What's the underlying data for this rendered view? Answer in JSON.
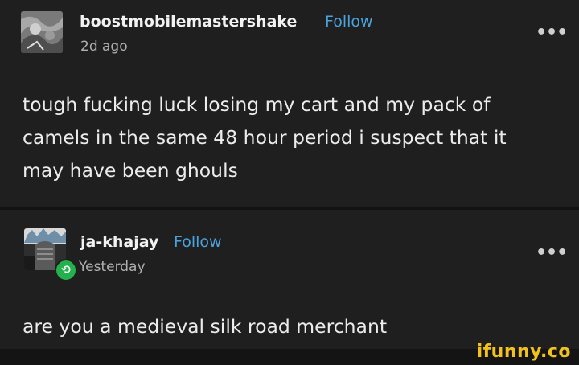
{
  "posts": [
    {
      "username": "boostmobilemastershake",
      "follow_label": "Follow",
      "timestamp": "2d ago",
      "more_label": "•••",
      "text": "tough fucking luck losing my cart and my pack of camels in the same 48 hour period i suspect that it may have been ghouls"
    },
    {
      "username": "ja-khajay",
      "follow_label": "Follow",
      "timestamp": "Yesterday",
      "more_label": "•••",
      "reblog_icon": "⟲",
      "text": "are you a medieval silk road merchant"
    }
  ],
  "watermark": "ifunny.co",
  "colors": {
    "background": "#1f1f1f",
    "follow": "#4aa3df",
    "reblog_badge": "#22b14c",
    "watermark": "#f3c11c"
  }
}
